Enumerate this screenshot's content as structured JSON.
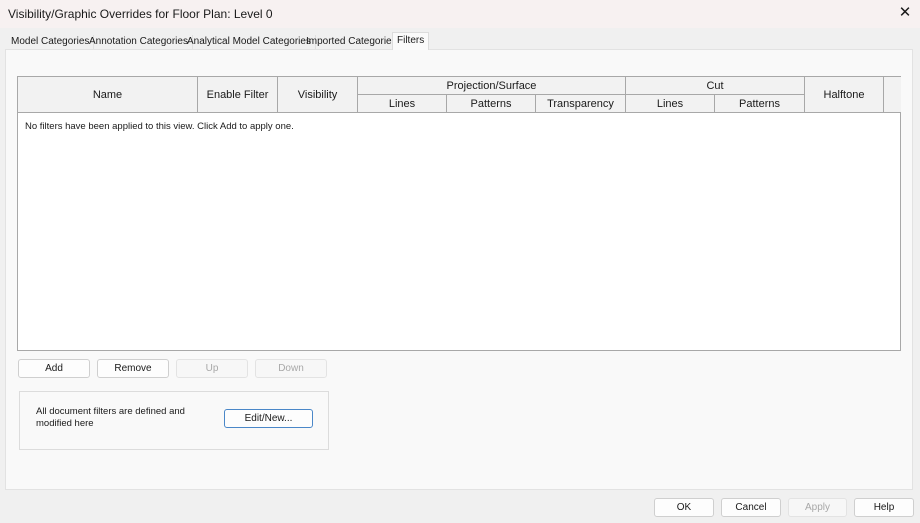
{
  "window": {
    "title": "Visibility/Graphic Overrides for Floor Plan: Level 0",
    "close_icon": "close-icon"
  },
  "tabs": [
    {
      "label": "Model Categories"
    },
    {
      "label": "Annotation Categories"
    },
    {
      "label": "Analytical Model Categories"
    },
    {
      "label": "Imported Categories"
    },
    {
      "label": "Filters",
      "active": true
    }
  ],
  "table": {
    "headers": {
      "name": "Name",
      "enable_filter": "Enable Filter",
      "visibility": "Visibility",
      "projection": "Projection/Surface",
      "proj_lines": "Lines",
      "proj_patterns": "Patterns",
      "proj_transparency": "Transparency",
      "cut": "Cut",
      "cut_lines": "Lines",
      "cut_patterns": "Patterns",
      "halftone": "Halftone"
    },
    "rows": [],
    "empty_message": "No filters have been applied to this view. Click Add to apply one."
  },
  "buttons": {
    "add": "Add",
    "remove": "Remove",
    "up": "Up",
    "down": "Down"
  },
  "group": {
    "text": "All document filters are defined and modified here",
    "edit_new": "Edit/New..."
  },
  "footer": {
    "ok": "OK",
    "cancel": "Cancel",
    "apply": "Apply",
    "help": "Help"
  }
}
